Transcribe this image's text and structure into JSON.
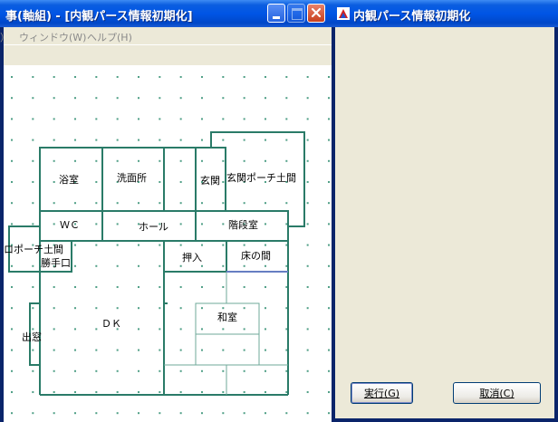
{
  "left_window": {
    "title": "事(軸組) - [内観パース情報初期化]",
    "menu": [
      "）",
      "ウィンドウ(W)",
      "ヘルプ(H)"
    ],
    "title_buttons": [
      "minimize",
      "maximize",
      "close"
    ]
  },
  "right_window": {
    "title": "内観パース情報初期化",
    "run_button": "実行(G)",
    "cancel_button": "取消(C)"
  },
  "floor_plan": {
    "rooms": {
      "bath": "浴室",
      "washroom": "洗面所",
      "entrance": "玄関",
      "entrance_porch": "玄関ポーチ土間",
      "wc": "ＷＣ",
      "hall": "ホール",
      "stairs": "階段室",
      "porch_floor": "ロポーチ土間",
      "back_door": "勝手口",
      "closet": "押入",
      "alcove": "床の間",
      "dk": "ＤＫ",
      "japanese_room": "和室",
      "bay_window": "出窓"
    }
  },
  "colors": {
    "titlebar": "#0055E5",
    "wall": "#2A7B68",
    "grid_dot": "#4F9F86",
    "button_border": "#003C74",
    "dialog_bg": "#ECE9D8",
    "close_button": "#D5552E"
  }
}
